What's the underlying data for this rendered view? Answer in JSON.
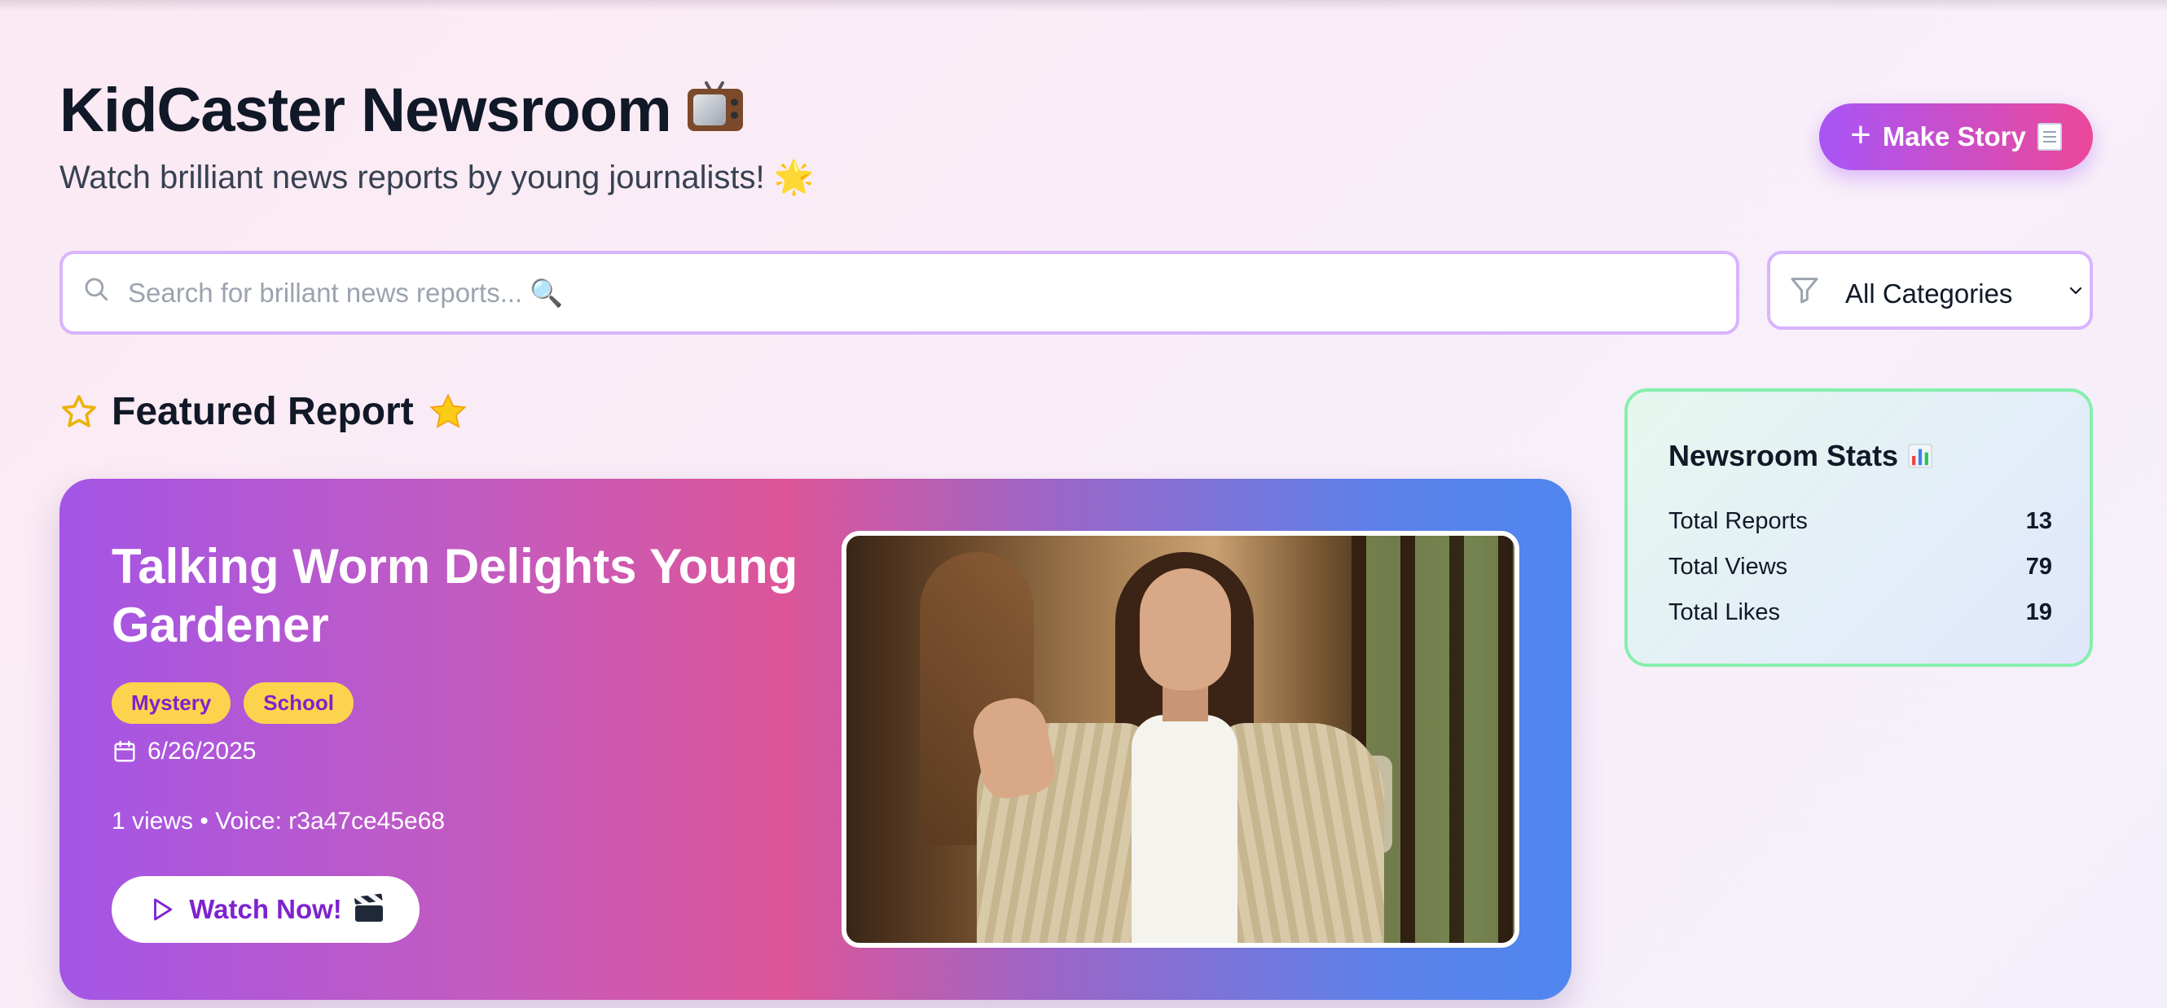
{
  "header": {
    "title": "KidCaster Newsroom",
    "title_icon": "tv-icon",
    "subtitle": "Watch brilliant news reports by young journalists! 🌟",
    "make_story_label": "Make Story",
    "make_story_icon": "memo-icon"
  },
  "search": {
    "placeholder": "Search for brillant news reports... 🔍",
    "value": ""
  },
  "filter": {
    "selected": "All Categories"
  },
  "featured": {
    "heading": "Featured Report",
    "report": {
      "title": "Talking Worm Delights Young Gardener",
      "tags": [
        "Mystery",
        "School"
      ],
      "date": "6/26/2025",
      "meta": "1 views • Voice: r3a47ce45e68",
      "watch_label": "Watch Now!",
      "watch_icon": "clapperboard-icon"
    }
  },
  "stats": {
    "title": "Newsroom Stats",
    "title_icon": "bar-chart-icon",
    "rows": [
      {
        "label": "Total Reports",
        "value": "13"
      },
      {
        "label": "Total Views",
        "value": "79"
      },
      {
        "label": "Total Likes",
        "value": "19"
      }
    ]
  },
  "colors": {
    "accent_purple": "#a855f7",
    "accent_pink": "#ec4899",
    "tag_yellow": "#fcd34d",
    "stats_border": "#86efac",
    "input_border": "#d8b4fe"
  }
}
